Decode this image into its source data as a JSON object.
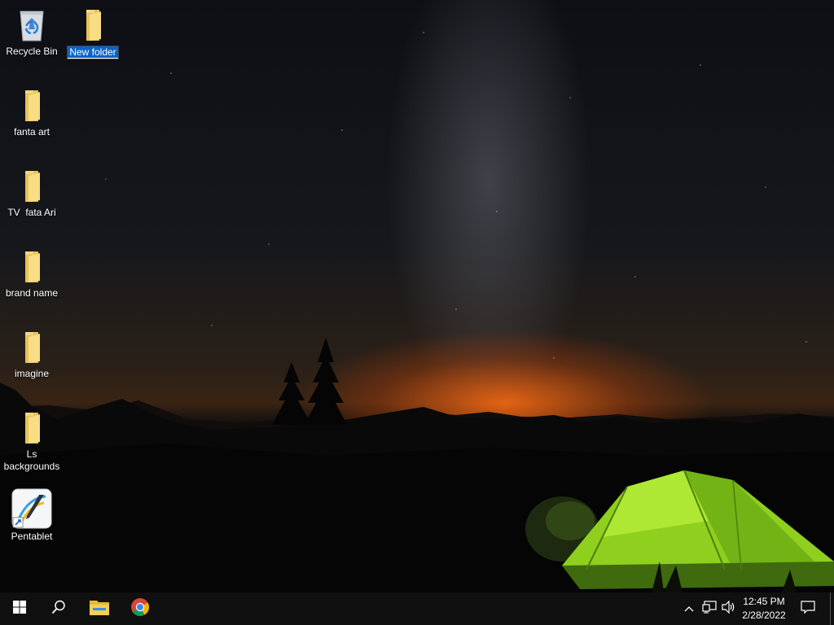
{
  "desktop": {
    "icons": [
      {
        "label": "Recycle Bin",
        "icon": "recycle-bin-icon"
      },
      {
        "label": "New folder",
        "icon": "folder-icon",
        "renaming": true
      },
      {
        "label": "fanta art",
        "icon": "folder-icon"
      },
      {
        "label": "TV  fata Ari",
        "icon": "folder-icon"
      },
      {
        "label": "brand name",
        "icon": "folder-icon"
      },
      {
        "label": "imagine",
        "icon": "folder-icon"
      },
      {
        "label": "Ls backgrounds",
        "icon": "folder-icon"
      },
      {
        "label": "Pentablet",
        "icon": "pentablet-shortcut-icon"
      }
    ]
  },
  "taskbar": {
    "start": "windows-start-icon",
    "search": "search-icon",
    "pinned": [
      "file-explorer-icon",
      "chrome-icon"
    ],
    "tray": [
      "chevron-up-icon",
      "network-icon",
      "volume-icon"
    ],
    "clock": {
      "time": "12:45 PM",
      "date": "2/28/2022"
    },
    "notifications": "action-center-icon"
  }
}
